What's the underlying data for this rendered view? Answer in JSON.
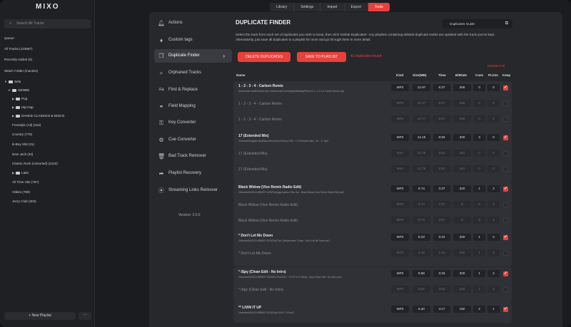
{
  "app": {
    "logo": "MIXO"
  },
  "window_controls": [
    {
      "color": "#ff5f57"
    },
    {
      "color": "#febc2e"
    },
    {
      "color": "#28c840"
    }
  ],
  "sidebar": {
    "search_placeholder": "Search All Tracks",
    "items": [
      {
        "label": "Queue"
      },
      {
        "label": "All Tracks (123697)"
      },
      {
        "label": "Recently Added (0)"
      },
      {
        "label": "Watch Folder (Inactive)"
      },
      {
        "label": "Sets"
      },
      {
        "label": "GENRE"
      },
      {
        "label": "Pop"
      },
      {
        "label": "Hip Hop"
      },
      {
        "label": "DANCE CLASSICS & DISCO"
      },
      {
        "label": "Freestyle (All) (224)"
      },
      {
        "label": "Country (779)"
      },
      {
        "label": "B-Boy Shit (31)"
      },
      {
        "label": "New Jack (33)"
      },
      {
        "label": "Classic Rock (Unsorted) (2110)"
      },
      {
        "label": "Latin"
      },
      {
        "label": "All Time Hits (787)"
      },
      {
        "label": "Oldies (769)"
      },
      {
        "label": "Jerzy Club (303)"
      }
    ],
    "new_playlist": "+ New Playlist",
    "more": "···"
  },
  "tabs": [
    {
      "label": "Library"
    },
    {
      "label": "Settings"
    },
    {
      "label": "Import"
    },
    {
      "label": "Export"
    },
    {
      "label": "Tools"
    }
  ],
  "tools": [
    {
      "label": "Actions",
      "icon": "bell-icon"
    },
    {
      "label": "Custom tags",
      "icon": "tag-icon"
    },
    {
      "label": "Duplicate Finder",
      "icon": "copy-icon"
    },
    {
      "label": "Orphaned Tracks",
      "icon": "search-icon"
    },
    {
      "label": "Find & Replace",
      "icon": "text-icon"
    },
    {
      "label": "Field Mapping",
      "icon": "link-icon"
    },
    {
      "label": "Key Converter",
      "icon": "key-icon"
    },
    {
      "label": "Cue Converter",
      "icon": "gear-icon"
    },
    {
      "label": "Bad Track Remover",
      "icon": "trash-icon"
    },
    {
      "label": "Playlist Recovery",
      "icon": "share-icon"
    },
    {
      "label": "Streaming Links Remover",
      "icon": "stream-icon"
    }
  ],
  "version": "Version: 2.0.0",
  "finder": {
    "title": "DUPLICATE FINDER",
    "guides": "Duplicates Guide",
    "description": "Select the track from each set of duplicates you wish to keep, then click 'Delete Duplicates'. Any playlists containing deleted duplicate tracks are updated with the track you've kept. Alternatively, just save all duplicates to a playlist for more and go through them in more detail.",
    "delete_btn": "DELETE DUPLICATES",
    "save_btn": "SAVE TO PLAYLIST",
    "found": "41 duplicates found",
    "select_all": "Deselect All",
    "columns": [
      "Name",
      "Kind",
      "Size(MB)",
      "Time",
      "BitRate",
      "Cues",
      "PLists",
      "Keep"
    ]
  },
  "groups": [
    {
      "rows": [
        {
          "name": "1 - 2 - 3 - 4 - Carbon Remix",
          "path": "/Users/mike.smith/Music/Home Sets/House/Cue/Sample/Bootleg/Remix/1-4 - 1-2-3-4 Carbon Remix.mp3",
          "kind": "MP3",
          "size": "12.97",
          "time": "6:37",
          "bitrate": "256",
          "cues": "0",
          "plists": "0",
          "keep": true
        },
        {
          "name": "1 - 2 - 3 - 4 - Carbon Remix",
          "path": "",
          "kind": "MP3",
          "size": "12.97",
          "time": "6:37",
          "bitrate": "256",
          "cues": "0",
          "plists": "0",
          "keep": false
        },
        {
          "name": "1 - 2 - 3 - 4 - Carbon Remix",
          "path": "",
          "kind": "MP3",
          "size": "13.77",
          "time": "6:57",
          "bitrate": "256",
          "cues": "0",
          "plists": "0",
          "keep": false
        }
      ]
    },
    {
      "rows": [
        {
          "name": "17 (Extended Mix)",
          "path": "/Volumes/Seagate/Vinyl/Rips/Scene/Tarsh Kinley 2016 - 17 (Extended Mix) - Sir - 17.mp3",
          "kind": "MP3",
          "size": "14.15",
          "time": "5:53",
          "bitrate": "320",
          "cues": "3",
          "plists": "0",
          "keep": true
        },
        {
          "name": "17 (Extended Mix)",
          "path": "",
          "kind": "M4A",
          "size": "12.78",
          "time": "5:53",
          "bitrate": "261",
          "cues": "0",
          "plists": "0",
          "keep": false
        },
        {
          "name": "17 (Extended Mix)",
          "path": "",
          "kind": "M4A",
          "size": "12.78",
          "time": "6:52",
          "bitrate": "261",
          "cues": "0",
          "plists": "0",
          "keep": false
        }
      ]
    },
    {
      "rows": [
        {
          "name": "Black Widow (Vice Remix Radio Edit)",
          "path": "/Volumes/MUSIC/LIBRARY 2020/Pop/Iggy Azalea / Rita Ora - Black Widow (Vice Remix Radio Edit).mp3",
          "kind": "MP3",
          "size": "8.74",
          "time": "3:37",
          "bitrate": "320",
          "cues": "1",
          "plists": "2",
          "keep": true
        },
        {
          "name": "Black Widow (Vice Remix Radio Edit)",
          "path": "",
          "kind": "MP3",
          "size": "8.74",
          "time": "3:37",
          "bitrate": "8",
          "cues": "0",
          "plists": "2",
          "keep": false
        },
        {
          "name": "Black Widow (Vice Remix Radio Edit)",
          "path": "",
          "kind": "MP3",
          "size": "8.74",
          "time": "3:57",
          "bitrate": "8",
          "cues": "0",
          "plists": "2",
          "keep": false
        }
      ]
    },
    {
      "rows": [
        {
          "name": "* Don't Let Me Down",
          "path": "/Volumes/MUSIC/LIBRARY 2020/Pop/The Chainsmokers / Daya - Don't Let Me Down.mp3",
          "kind": "MP3",
          "size": "8.23",
          "time": "3:24",
          "bitrate": "320",
          "cues": "1",
          "plists": "2",
          "keep": true
        },
        {
          "name": "* Don't Let Me Down",
          "path": "",
          "kind": "MP3",
          "size": "8.19",
          "time": "1:24",
          "bitrate": "320",
          "cues": "1",
          "plists": "2",
          "keep": false
        }
      ]
    },
    {
      "rows": [
        {
          "name": "* iSpy (Clean Edit - No Intro)",
          "path": "/Volumes/MUSIC/LIBRARY FADAHN 2020/2017 - KYLE ft Lil Yachty - iSpy (Clean Edit - No Intro).mp3",
          "kind": "MP3",
          "size": "8.56",
          "time": "3:43",
          "bitrate": "320",
          "cues": "1",
          "plists": "2",
          "keep": true
        },
        {
          "name": "* iSpy (Clean Edit - No Intro)",
          "path": "",
          "kind": "MP3",
          "size": "8.52",
          "time": "3:83",
          "bitrate": "320",
          "cues": "1",
          "plists": "2",
          "keep": false
        }
      ]
    },
    {
      "rows": [
        {
          "name": "** LIVIN IT UP",
          "path": "/Volumes/MUSIC/LIBRARY 2020/Pop/LIVIN IT UP.mp3",
          "kind": "MP3",
          "size": "6.20",
          "time": "4:17",
          "bitrate": "192",
          "cues": "2",
          "plists": "1",
          "keep": true
        }
      ]
    }
  ],
  "colors": {
    "accent": "#e8413a",
    "panel": "#27282c",
    "row": "#303136"
  }
}
